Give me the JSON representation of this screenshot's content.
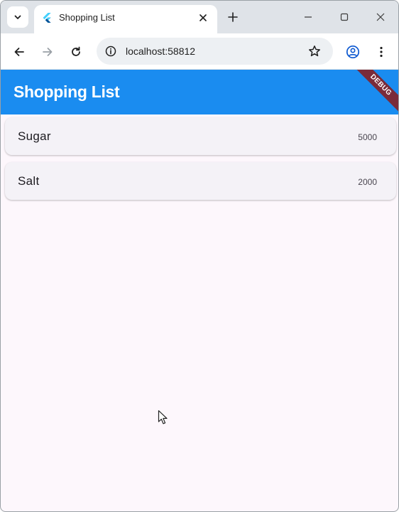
{
  "browser": {
    "tab": {
      "title": "Shopping List",
      "favicon": "flutter-icon"
    },
    "address_bar": {
      "url": "localhost:58812"
    },
    "icons": {
      "tab_search": "chevron-down-icon",
      "close_tab": "close-icon",
      "new_tab": "plus-icon",
      "minimize": "minimize-icon",
      "maximize": "maximize-icon",
      "close_window": "close-icon",
      "back": "back-arrow-icon",
      "forward": "forward-arrow-icon",
      "reload": "reload-icon",
      "site_info": "info-icon",
      "bookmark": "star-icon",
      "profile": "profile-icon",
      "menu": "kebab-menu-icon"
    }
  },
  "app": {
    "title": "Shopping List",
    "debug_banner": "DEBUG",
    "colors": {
      "app_bar": "#1a8cf0",
      "background": "#fdf7fc",
      "card": "#f4f2f7",
      "debug_banner": "#7a2b3a"
    },
    "items": [
      {
        "name": "Sugar",
        "quantity": "5000"
      },
      {
        "name": "Salt",
        "quantity": "2000"
      }
    ]
  }
}
